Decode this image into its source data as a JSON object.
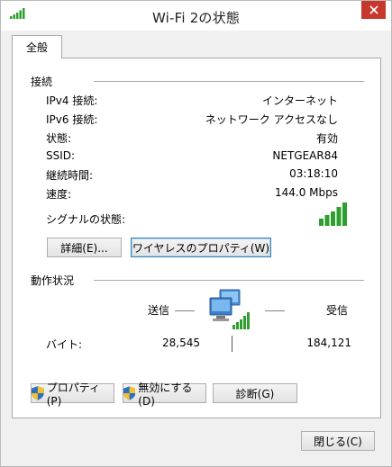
{
  "window": {
    "title": "Wi-Fi 2の状態",
    "title_icon": "wifi-signal-icon",
    "close_icon": "close-icon"
  },
  "tabs": [
    {
      "label": "全般",
      "selected": true
    }
  ],
  "connection": {
    "heading": "接続",
    "rows": [
      {
        "label": "IPv4 接続:",
        "value": "インターネット"
      },
      {
        "label": "IPv6 接続:",
        "value": "ネットワーク アクセスなし"
      },
      {
        "label": "状態:",
        "value": "有効"
      },
      {
        "label": "SSID:",
        "value": "NETGEAR84"
      },
      {
        "label": "継続時間:",
        "value": "03:18:10"
      },
      {
        "label": "速度:",
        "value": "144.0 Mbps"
      }
    ],
    "signal_label": "シグナルの状態:",
    "signal_bars": 5,
    "signal_bars_max": 5,
    "signal_color": "#2e9f2e",
    "details_button": "詳細(E)...",
    "wireless_props_button": "ワイヤレスのプロパティ(W)"
  },
  "activity": {
    "heading": "動作状況",
    "sent_label": "送信",
    "received_label": "受信",
    "bytes_label": "バイト:",
    "bytes_sent": "28,545",
    "bytes_received": "184,121",
    "network_icon": "network-computers-icon"
  },
  "actions": {
    "properties_button": "プロパティ(P)",
    "disable_button": "無効にする(D)",
    "diagnose_button": "診断(G)",
    "shield_icon": "uac-shield-icon"
  },
  "footer": {
    "close_button": "閉じる(C)"
  },
  "colors": {
    "close_red": "#c7382c",
    "accent_border": "#3c7fb1"
  }
}
